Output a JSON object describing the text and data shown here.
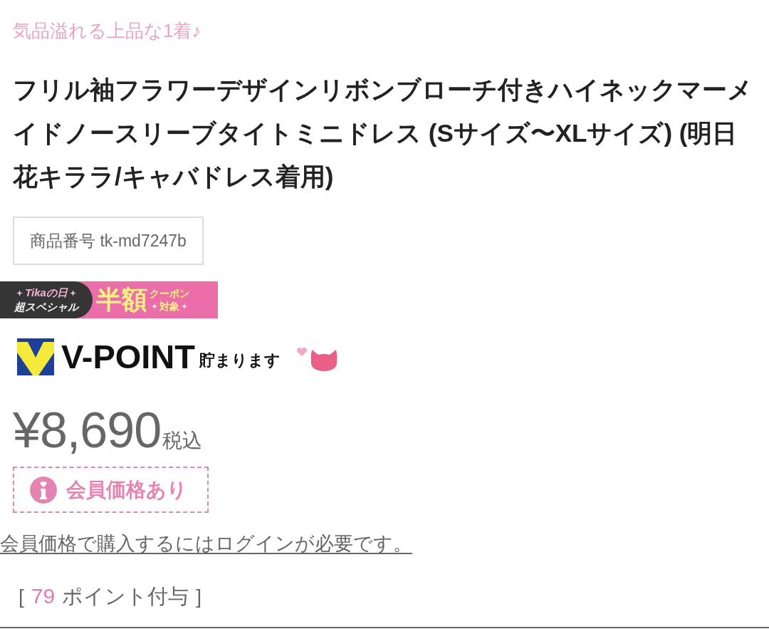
{
  "catchcopy": "気品溢れる上品な1着♪",
  "title": "フリル袖フラワーデザインリボンブローチ付きハイネックマーメイドノースリーブタイトミニドレス (Sサイズ〜XLサイズ) (明日花キララ/キャバドレス着用)",
  "product_number": "商品番号 tk-md7247b",
  "campaign_banner": {
    "left_top": "Tikaの日",
    "left_bottom": "超スペシャル",
    "headline": "半額",
    "right_top": "クーポン",
    "right_bottom": "対象"
  },
  "vpoint": {
    "logo_text": "V-POINT",
    "caption": "貯まります"
  },
  "price": {
    "amount": "¥8,690",
    "tax_note": "税込"
  },
  "member_price_badge": "会員価格あり",
  "login_link": "会員価格で購入するにはログインが必要です。",
  "points": {
    "open": "[",
    "value": "79",
    "label": "ポイント付与",
    "close": "]"
  }
}
